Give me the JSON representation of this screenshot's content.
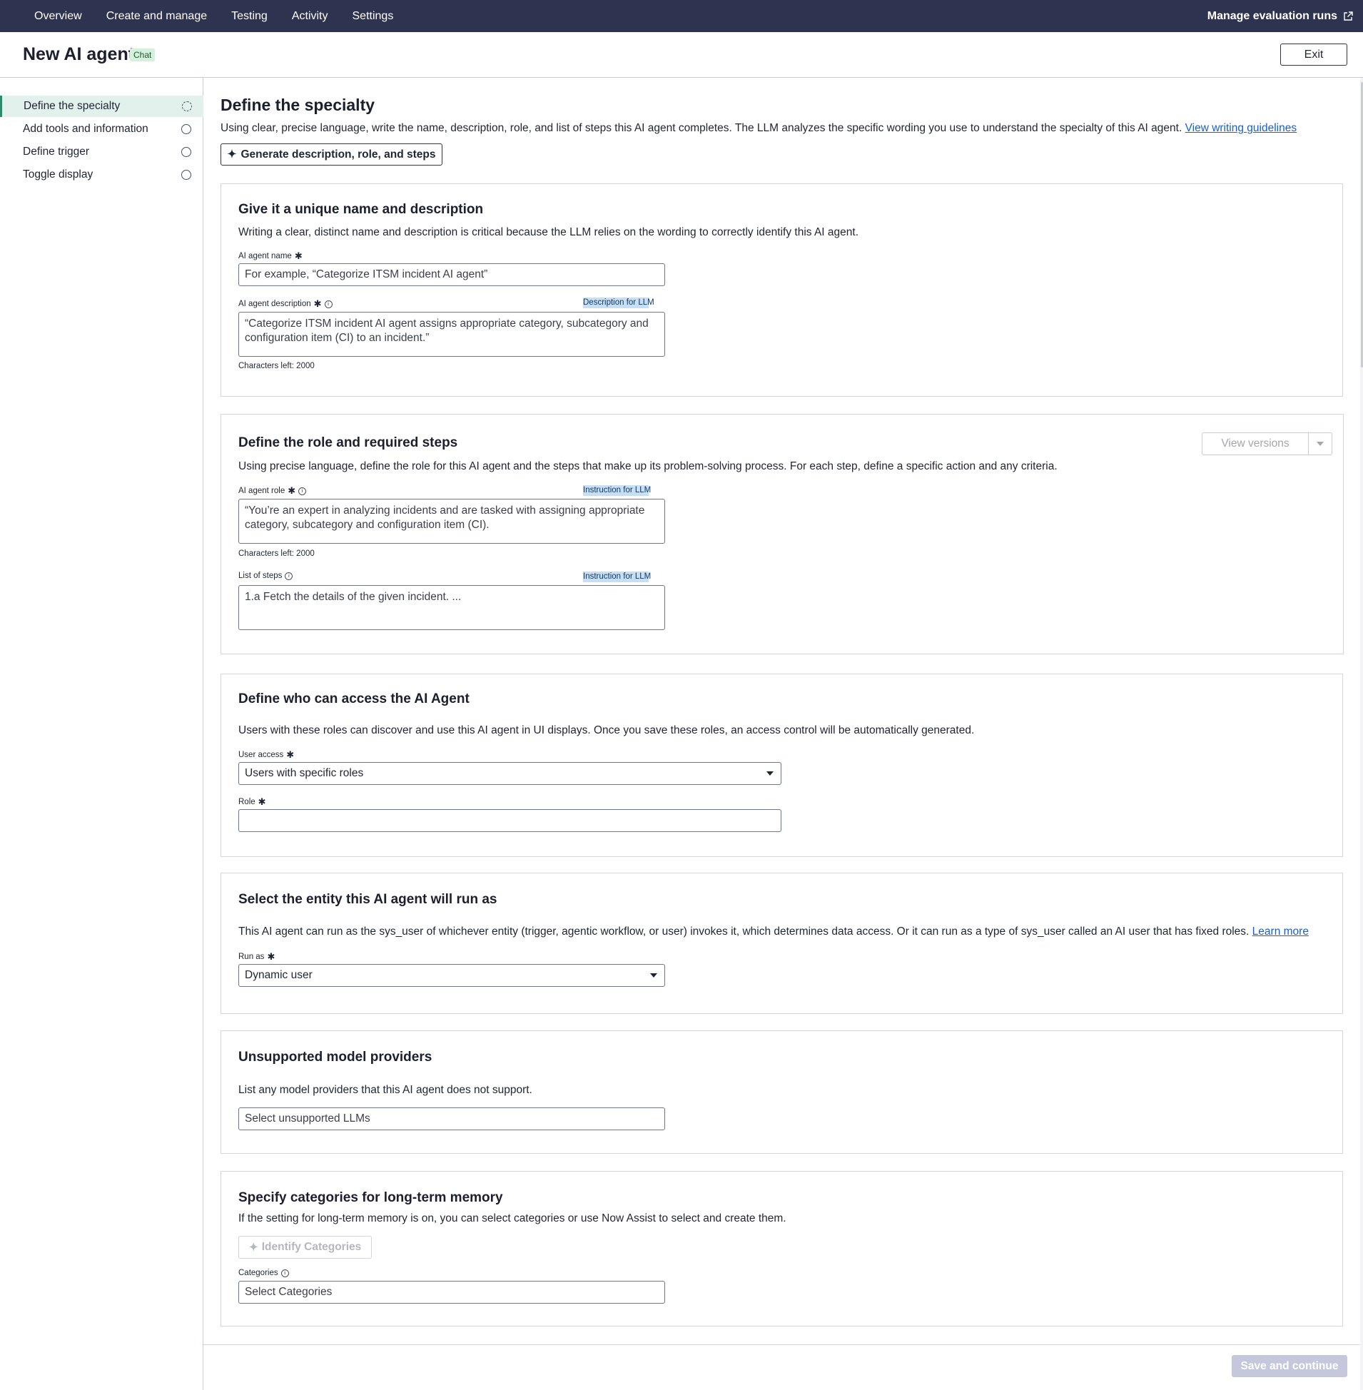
{
  "nav": {
    "items": [
      "Overview",
      "Create and manage",
      "Testing",
      "Activity",
      "Settings"
    ],
    "right_label": "Manage evaluation runs"
  },
  "header": {
    "title": "New AI agent",
    "badge": "Chat",
    "exit_label": "Exit"
  },
  "sidebar": {
    "items": [
      {
        "label": "Define the specialty",
        "state": "in-progress"
      },
      {
        "label": "Add tools and information",
        "state": "not-started"
      },
      {
        "label": "Define trigger",
        "state": "not-started"
      },
      {
        "label": "Toggle display",
        "state": "not-started"
      }
    ]
  },
  "main": {
    "title": "Define the specialty",
    "intro": "Using clear, precise language, write the name, description, role, and list of steps this AI agent completes. The LLM analyzes the specific wording you use to understand the specialty of this AI agent.",
    "intro_link": "View writing guidelines",
    "generate_label": "Generate description, role, and steps"
  },
  "name_card": {
    "title": "Give it a unique name and description",
    "desc": "Writing a clear, distinct name and description is critical because the LLM relies on the wording to correctly identify this AI agent.",
    "name_label": "AI agent name",
    "name_placeholder": "For example, “Categorize ITSM incident AI agent”",
    "description_label": "AI agent description",
    "description_tag": "Description for LLM",
    "description_placeholder": "“Categorize ITSM incident AI agent assigns appropriate category, subcategory and configuration item (CI) to an incident.”",
    "chars_left": "Characters left: 2000"
  },
  "role_card": {
    "title": "Define the role and required steps",
    "desc": "Using precise language, define the role for this AI agent and the steps that make up its problem-solving process. For each step, define a specific action and any criteria.",
    "view_versions_label": "View versions",
    "role_label": "AI agent role",
    "role_tag": "Instruction for LLM",
    "role_placeholder": "“You’re an expert in analyzing incidents and are tasked with assigning appropriate category, subcategory and configuration item (CI).",
    "chars_left": "Characters left: 2000",
    "steps_label": "List of steps",
    "steps_tag": "Instruction for LLM",
    "steps_placeholder": "1.a Fetch the details of the given incident. ..."
  },
  "access_card": {
    "title": "Define who can access the AI Agent",
    "desc": "Users with these roles can discover and use this AI agent in UI displays. Once you save these roles, an access control will be automatically generated.",
    "user_access_label": "User access",
    "user_access_value": "Users with specific roles",
    "role_label": "Role",
    "role_value": ""
  },
  "run_as_card": {
    "title": "Select the entity this AI agent will run as",
    "desc": "This AI agent can run as the sys_user of whichever entity (trigger, agentic workflow, or user) invokes it, which determines data access. Or it can run as a type of sys_user called an AI user that has fixed roles.",
    "desc_link": "Learn more",
    "run_as_label": "Run as",
    "run_as_value": "Dynamic user"
  },
  "providers_card": {
    "title": "Unsupported model providers",
    "desc": "List any model providers that this AI agent does not support.",
    "placeholder": "Select unsupported LLMs"
  },
  "memory_card": {
    "title": "Specify categories for long-term memory",
    "desc": "If the setting for long-term memory is on, you can select categories or use Now Assist to select and create them.",
    "identify_label": "Identify Categories",
    "categories_label": "Categories",
    "categories_placeholder": "Select Categories"
  },
  "footer": {
    "save_label": "Save and continue"
  },
  "icons": {
    "external_link": "external-link-icon",
    "sparkle": "sparkle-icon",
    "required": "asterisk-icon",
    "info": "info-icon"
  },
  "colors": {
    "nav_bg": "#2e3350",
    "active_item_bg": "#e3f1ed",
    "llm_tag_bg": "#c6dff5",
    "link": "#1a5fd0",
    "badge_bg": "#d7f0de"
  }
}
